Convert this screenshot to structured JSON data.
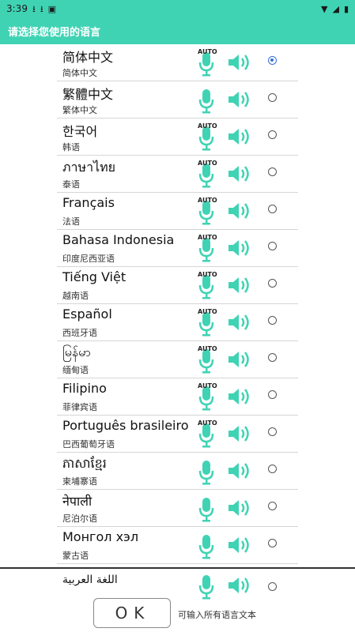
{
  "status_bar": {
    "time": "3:39"
  },
  "app_bar": {
    "title": "请选择您使用的语言"
  },
  "languages": [
    {
      "native": "简体中文",
      "chinese": "简体中文",
      "auto": "AUTO",
      "selected": true
    },
    {
      "native": "繁體中文",
      "chinese": "繁体中文",
      "auto": "",
      "selected": false
    },
    {
      "native": "한국어",
      "chinese": "韩语",
      "auto": "AUTO",
      "selected": false
    },
    {
      "native": "ภาษาไทย",
      "chinese": "泰语",
      "auto": "AUTO",
      "selected": false
    },
    {
      "native": "Français",
      "chinese": "法语",
      "auto": "AUTO",
      "selected": false
    },
    {
      "native": "Bahasa Indonesia",
      "chinese": "印度尼西亚语",
      "auto": "AUTO",
      "selected": false
    },
    {
      "native": "Tiếng Việt",
      "chinese": "越南语",
      "auto": "AUTO",
      "selected": false
    },
    {
      "native": "Español",
      "chinese": "西班牙语",
      "auto": "AUTO",
      "selected": false
    },
    {
      "native": "မြန်မာ",
      "chinese": "缅甸语",
      "auto": "AUTO",
      "selected": false
    },
    {
      "native": "Filipino",
      "chinese": "菲律宾语",
      "auto": "AUTO",
      "selected": false
    },
    {
      "native": "Português brasileiro",
      "chinese": "巴西葡萄牙语",
      "auto": "AUTO",
      "selected": false
    },
    {
      "native": "ភាសាខ្មែរ",
      "chinese": "柬埔寨语",
      "auto": "",
      "selected": false
    },
    {
      "native": "नेपाली",
      "chinese": "尼泊尔语",
      "auto": "",
      "selected": false
    },
    {
      "native": "Монгол хэл",
      "chinese": "蒙古语",
      "auto": "",
      "selected": false
    }
  ],
  "last_language": {
    "native": "اللغة العربية"
  },
  "footer": {
    "ok_label": "OK",
    "hint": "可输入所有语言文本"
  },
  "colors": {
    "accent": "#3fd3b4",
    "radio_selected": "#3a6fd8"
  }
}
